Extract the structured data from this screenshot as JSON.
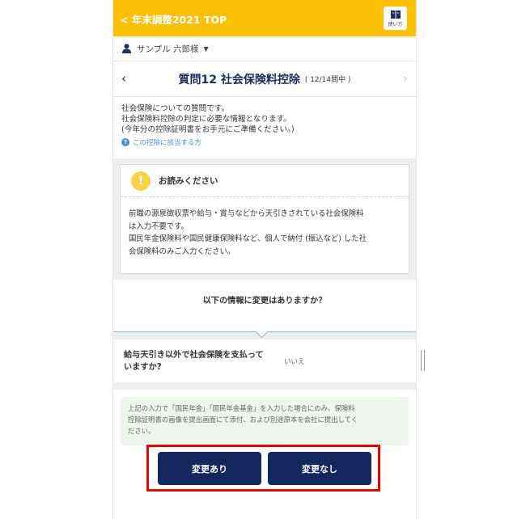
{
  "topbar": {
    "back_label": "< 年末調整2021 TOP",
    "guide_label": "使い方",
    "guide_icon": "book-icon"
  },
  "user": {
    "name": "サンプル 六郎様",
    "icon": "person-icon",
    "caret": "▼"
  },
  "question_header": {
    "prev": "‹",
    "title": "質問12 社会保険料控除",
    "progress": "( 12/14問中 )",
    "next": "›"
  },
  "intro": {
    "lines": [
      "社会保険についての質問です。",
      "社会保険料控除の判定に必要な情報となります。",
      "(今年分の控除証明書をお手元にご準備ください。)"
    ],
    "help_link": "この控除に該当する方"
  },
  "notice": {
    "title": "お読みください",
    "lines": [
      "前職の源泉徴収票や給与・賞与などから天引きされている社会保険料",
      "は入力不要です。",
      "国民年金保険料や国民健康保険料など、個人で納付 (振込など) した社",
      "会保険料のみご入力ください。"
    ]
  },
  "confirm_question": "以下の情報に変更はありますか？",
  "answer": {
    "question_line1": "給与天引き以外で社会保険を支払って",
    "question_line2": "いますか?",
    "value": "いいえ"
  },
  "note": {
    "lines": [
      "上記の入力で「国民年金」「国民年金基金」を入力した場合にのみ、保険料",
      "控除証明書の画像を提出画面にて添付、および別途原本を会社に提出してく",
      "ださい。"
    ]
  },
  "buttons": {
    "change": "変更あり",
    "no_change": "変更なし"
  },
  "colors": {
    "accent_yellow": "#fbbf04",
    "navy": "#13285c",
    "highlight_red": "#e00000",
    "note_green": "#edf5ed"
  }
}
